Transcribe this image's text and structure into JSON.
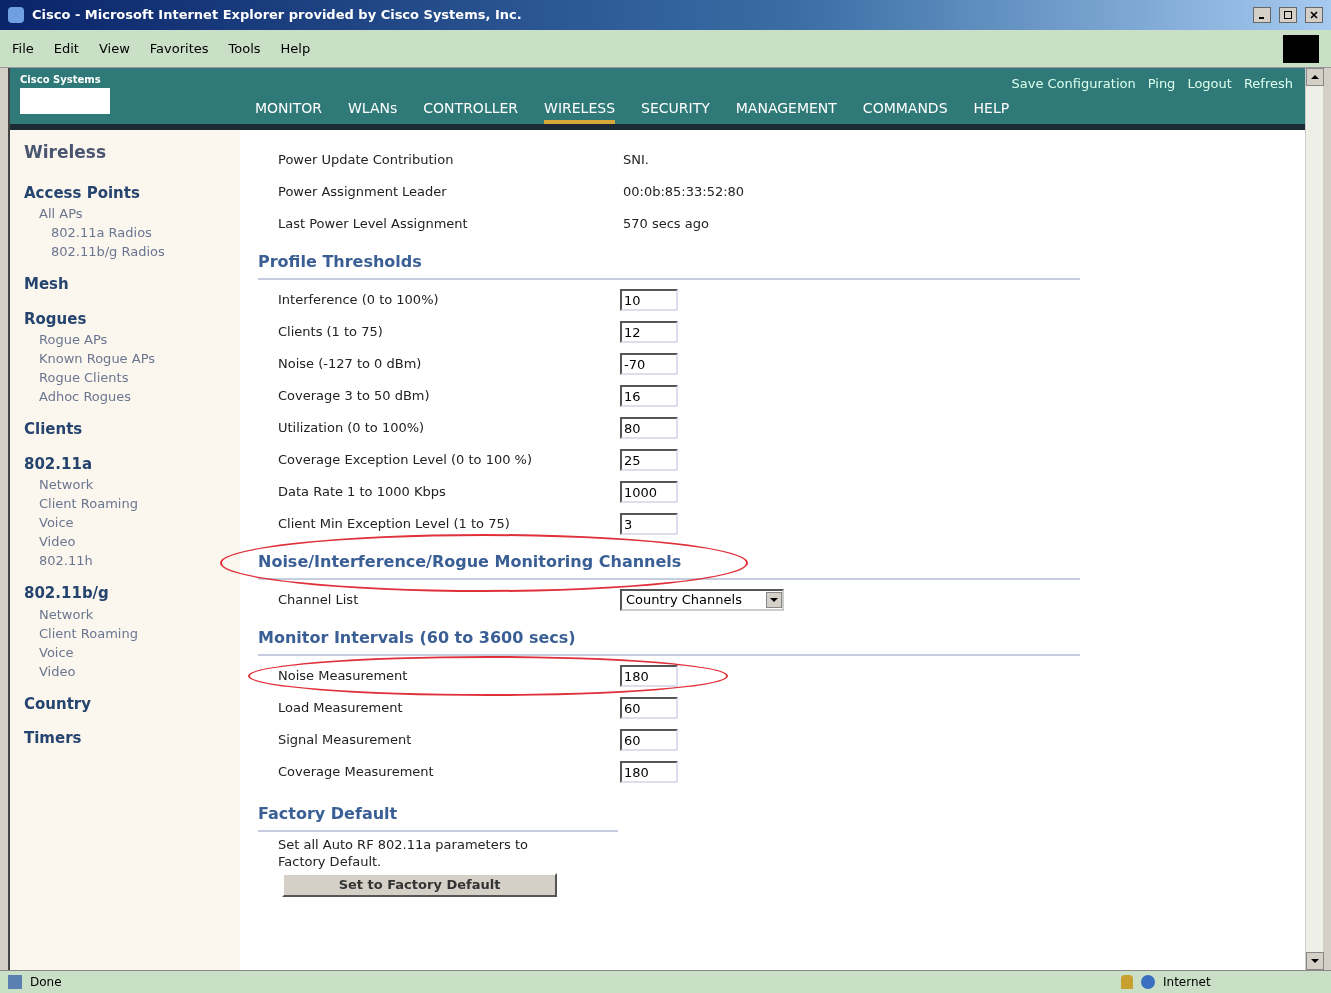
{
  "window": {
    "title": "Cisco - Microsoft Internet Explorer provided by Cisco Systems, Inc."
  },
  "menu": [
    "File",
    "Edit",
    "View",
    "Favorites",
    "Tools",
    "Help"
  ],
  "header": {
    "logo": "Cisco Systems",
    "links": [
      "Save Configuration",
      "Ping",
      "Logout",
      "Refresh"
    ],
    "tabs": [
      {
        "label": "MONITOR",
        "selected": false
      },
      {
        "label": "WLANs",
        "selected": false
      },
      {
        "label": "CONTROLLER",
        "selected": false
      },
      {
        "label": "WIRELESS",
        "selected": true
      },
      {
        "label": "SECURITY",
        "selected": false
      },
      {
        "label": "MANAGEMENT",
        "selected": false
      },
      {
        "label": "COMMANDS",
        "selected": false
      },
      {
        "label": "HELP",
        "selected": false
      }
    ]
  },
  "sidebar": {
    "title": "Wireless",
    "items": [
      {
        "label": "Access Points",
        "children": [
          {
            "label": "All APs",
            "children": [
              {
                "label": "802.11a Radios"
              },
              {
                "label": "802.11b/g Radios"
              }
            ]
          }
        ]
      },
      {
        "label": "Mesh"
      },
      {
        "label": "Rogues",
        "children": [
          {
            "label": "Rogue APs"
          },
          {
            "label": "Known Rogue APs"
          },
          {
            "label": "Rogue Clients"
          },
          {
            "label": "Adhoc Rogues"
          }
        ]
      },
      {
        "label": "Clients"
      },
      {
        "label": "802.11a",
        "children": [
          {
            "label": "Network"
          },
          {
            "label": "Client Roaming"
          },
          {
            "label": "Voice"
          },
          {
            "label": "Video"
          },
          {
            "label": "802.11h"
          }
        ]
      },
      {
        "label": "802.11b/g",
        "children": [
          {
            "label": "Network"
          },
          {
            "label": "Client Roaming"
          },
          {
            "label": "Voice"
          },
          {
            "label": "Video"
          }
        ]
      },
      {
        "label": "Country"
      },
      {
        "label": "Timers"
      }
    ]
  },
  "info_rows": [
    {
      "label": "Power Update Contribution",
      "value": "SNI."
    },
    {
      "label": "Power Assignment Leader",
      "value": "00:0b:85:33:52:80"
    },
    {
      "label": "Last Power Level Assignment",
      "value": "570 secs ago"
    }
  ],
  "sections": [
    {
      "title": "Profile Thresholds",
      "highlighted": false,
      "fields": [
        {
          "kind": "input",
          "label": "Interference (0 to 100%)",
          "value": "10",
          "highlighted": false
        },
        {
          "kind": "input",
          "label": "Clients (1 to 75)",
          "value": "12",
          "highlighted": false
        },
        {
          "kind": "input",
          "label": "Noise (-127 to 0 dBm)",
          "value": "-70",
          "highlighted": false
        },
        {
          "kind": "input",
          "label": "Coverage 3 to 50 dBm)",
          "value": "16",
          "highlighted": false
        },
        {
          "kind": "input",
          "label": "Utilization (0 to 100%)",
          "value": "80",
          "highlighted": false
        },
        {
          "kind": "input",
          "label": "Coverage Exception Level (0 to 100 %)",
          "value": "25",
          "highlighted": false
        },
        {
          "kind": "input",
          "label": "Data Rate 1 to 1000 Kbps",
          "value": "1000",
          "highlighted": false
        },
        {
          "kind": "input",
          "label": "Client Min Exception Level (1 to 75)",
          "value": "3",
          "highlighted": false
        }
      ]
    },
    {
      "title": "Noise/Interference/Rogue Monitoring Channels",
      "highlighted": true,
      "fields": [
        {
          "kind": "select",
          "label": "Channel List",
          "value": "Country Channels",
          "highlighted": false
        }
      ]
    },
    {
      "title": "Monitor Intervals (60 to 3600 secs)",
      "highlighted": false,
      "fields": [
        {
          "kind": "input",
          "label": "Noise Measurement",
          "value": "180",
          "highlighted": true
        },
        {
          "kind": "input",
          "label": "Load Measurement",
          "value": "60",
          "highlighted": false
        },
        {
          "kind": "input",
          "label": "Signal Measurement",
          "value": "60",
          "highlighted": false
        },
        {
          "kind": "input",
          "label": "Coverage Measurement",
          "value": "180",
          "highlighted": false
        }
      ]
    }
  ],
  "factory_default": {
    "title": "Factory Default",
    "text": "Set all Auto RF 802.11a parameters to Factory Default.",
    "button": "Set to Factory Default"
  },
  "status_bar": {
    "status": "Done",
    "zone": "Internet"
  }
}
